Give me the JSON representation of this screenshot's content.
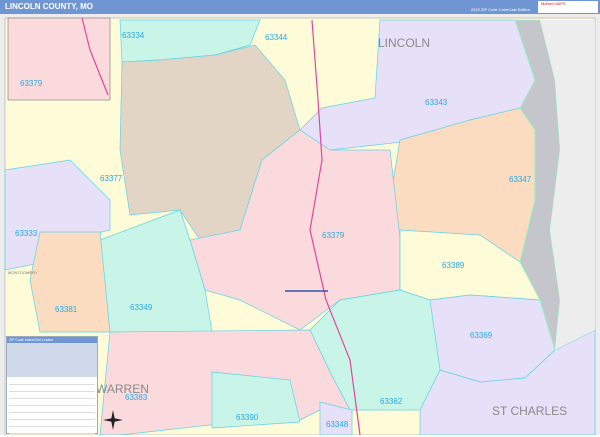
{
  "header": {
    "title": "LINCOLN COUNTY, MO",
    "edition": "2022 ZIP Code ColorCast Edition",
    "logo": "Market MAPS"
  },
  "map": {
    "counties": [
      "LINCOLN",
      "WARREN",
      "ST CHARLES",
      "MONTGOMERY"
    ],
    "zips": [
      "63334",
      "63344",
      "63343",
      "63377",
      "63347",
      "63333",
      "63379",
      "63389",
      "63381",
      "63349",
      "63369",
      "63383",
      "63390",
      "63362",
      "63348"
    ],
    "inset_zip": "63379"
  },
  "legend": {
    "title": "ZIP Code Index/Grid Locator"
  },
  "colors": {
    "header": "#6f96d3",
    "label": "#29a9e1",
    "pink": "#fadadd",
    "tan": "#e3d5c5",
    "yellow": "#fdfbd8",
    "lavender": "#e6e0f8",
    "peach": "#fbdcc0",
    "mint": "#c9f5e8",
    "river": "#c4c6cc"
  }
}
